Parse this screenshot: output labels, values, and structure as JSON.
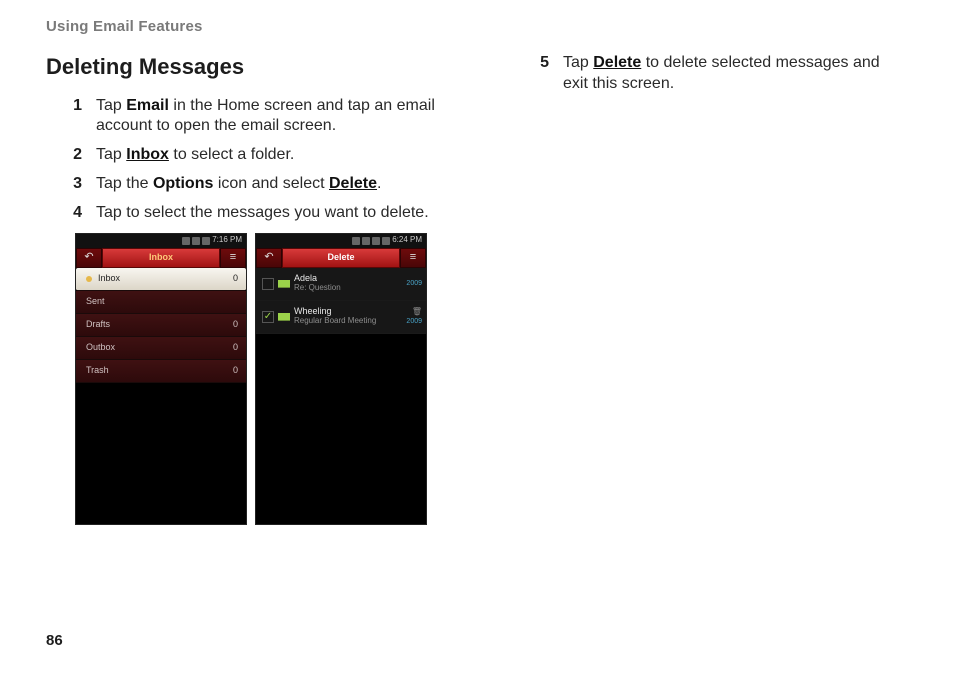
{
  "header": "Using Email Features",
  "title": "Deleting Messages",
  "steps_left": [
    {
      "n": "1",
      "parts": [
        {
          "t": "Tap "
        },
        {
          "t": "Email",
          "b": true
        },
        {
          "t": " in the Home screen and tap an email account to open the email screen."
        }
      ]
    },
    {
      "n": "2",
      "parts": [
        {
          "t": "Tap "
        },
        {
          "t": "Inbox",
          "b": true,
          "u": true
        },
        {
          "t": " to select a folder."
        }
      ]
    },
    {
      "n": "3",
      "parts": [
        {
          "t": "Tap the "
        },
        {
          "t": "Options",
          "b": true
        },
        {
          "t": " icon and select "
        },
        {
          "t": "Delete",
          "b": true,
          "u": true
        },
        {
          "t": "."
        }
      ]
    },
    {
      "n": "4",
      "parts": [
        {
          "t": "Tap to select the messages you want to delete."
        }
      ]
    }
  ],
  "steps_right": [
    {
      "n": "5",
      "parts": [
        {
          "t": "Tap "
        },
        {
          "t": "Delete",
          "b": true,
          "u": true
        },
        {
          "t": " to delete selected messages and exit this screen."
        }
      ]
    }
  ],
  "phone1": {
    "time": "7:16 PM",
    "topbar": "Inbox",
    "back": "↶",
    "menu": "≡",
    "folders": [
      {
        "name": "Inbox",
        "count": "0",
        "selected": true,
        "dot": true
      },
      {
        "name": "Sent",
        "count": ""
      },
      {
        "name": "Drafts",
        "count": "0"
      },
      {
        "name": "Outbox",
        "count": "0"
      },
      {
        "name": "Trash",
        "count": "0"
      }
    ]
  },
  "phone2": {
    "time": "6:24 PM",
    "topbar": "Delete",
    "back": "↶",
    "menu": "≡",
    "messages": [
      {
        "from": "Adela",
        "subject": "Re: Question",
        "year": "2009",
        "checked": false,
        "hasTrash": false
      },
      {
        "from": "Wheeling",
        "subject": "Regular Board Meeting",
        "year": "2009",
        "checked": true,
        "hasTrash": true
      }
    ]
  },
  "page_number": "86"
}
